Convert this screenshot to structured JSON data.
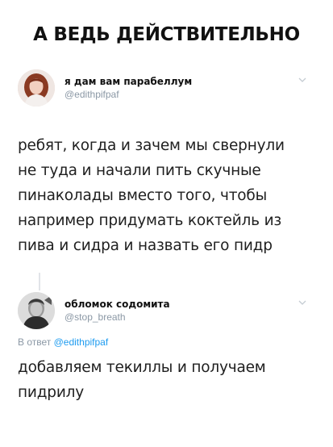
{
  "headline": "А ВЕДЬ ДЕЙСТВИТЕЛЬНО",
  "tweets": [
    {
      "display_name": "я дам вам парабеллум",
      "handle": "@edithpifpaf",
      "text_lines": [
        "ребят, когда и зачем мы свернули",
        "не туда и начали пить скучные",
        "пинаколады вместо того, чтобы",
        "например придумать коктейль из",
        "пива и сидра и назвать его пидр"
      ]
    },
    {
      "display_name": "обломок содомита",
      "handle": "@stop_breath",
      "replying_prefix": "В ответ",
      "replying_to": "@edithpifpaf",
      "text_lines": [
        "добавляем текиллы и получаем",
        "пидрилу"
      ]
    }
  ],
  "icons": {
    "menu_caret": "chevron-down-icon"
  },
  "colors": {
    "handle": "#8b98a5",
    "mention": "#1d9bf0",
    "text": "#1f1f1f"
  }
}
